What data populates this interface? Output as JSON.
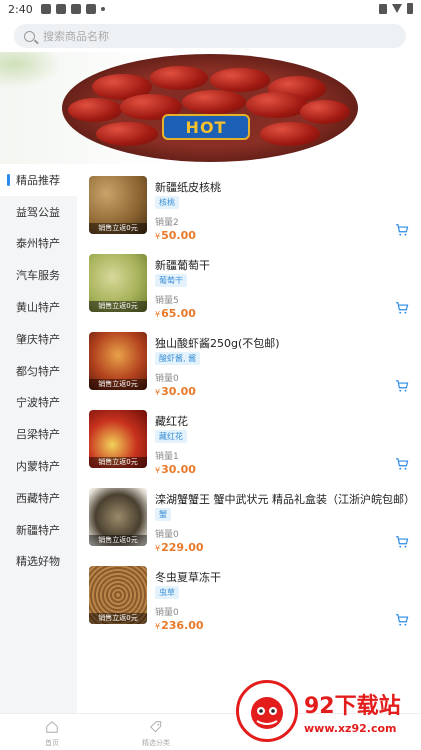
{
  "status_bar": {
    "time": "2:40"
  },
  "search": {
    "placeholder": "搜索商品名称"
  },
  "banner": {
    "badge": "HOT"
  },
  "sidebar": {
    "items": [
      {
        "label": "精品推荐",
        "active": true
      },
      {
        "label": "益驾公益"
      },
      {
        "label": "泰州特产"
      },
      {
        "label": "汽车服务"
      },
      {
        "label": "黄山特产"
      },
      {
        "label": "肇庆特产"
      },
      {
        "label": "都匀特产"
      },
      {
        "label": "宁波特产"
      },
      {
        "label": "吕梁特产"
      },
      {
        "label": "内蒙特产"
      },
      {
        "label": "西藏特产"
      },
      {
        "label": "新疆特产"
      },
      {
        "label": "精选好物"
      }
    ]
  },
  "products": [
    {
      "name": "新疆纸皮核桃",
      "tag": "核桃",
      "sales": "销量2",
      "currency": "¥",
      "price": "50.00",
      "thumb_caption": "销售立返0元"
    },
    {
      "name": "新疆葡萄干",
      "tag": "葡萄干",
      "sales": "销量5",
      "currency": "¥",
      "price": "65.00",
      "thumb_caption": "销售立返0元"
    },
    {
      "name": "独山酸虾酱250g(不包邮)",
      "tag": "酸虾酱, 酱",
      "sales": "销量0",
      "currency": "¥",
      "price": "30.00",
      "thumb_caption": "销售立返0元"
    },
    {
      "name": "藏红花",
      "tag": "藏红花",
      "sales": "销量1",
      "currency": "¥",
      "price": "30.00",
      "thumb_caption": "销售立返0元"
    },
    {
      "name": "滦湖蟹蟹王 蟹中武状元 精品礼盒装（江浙沪皖包邮）",
      "tag": "蟹",
      "sales": "销量0",
      "currency": "¥",
      "price": "229.00",
      "thumb_caption": "销售立返0元"
    },
    {
      "name": "冬虫夏草冻干",
      "tag": "虫草",
      "sales": "销量0",
      "currency": "¥",
      "price": "236.00",
      "thumb_caption": "销售立返0元"
    }
  ],
  "tabbar": {
    "home": "首页",
    "second": "精选分类"
  },
  "watermark": {
    "brand": "92下载站",
    "url": "www.xz92.com"
  },
  "colors": {
    "accent": "#2a8be8",
    "price": "#e8792a",
    "tag_bg": "#e4f2fc"
  }
}
